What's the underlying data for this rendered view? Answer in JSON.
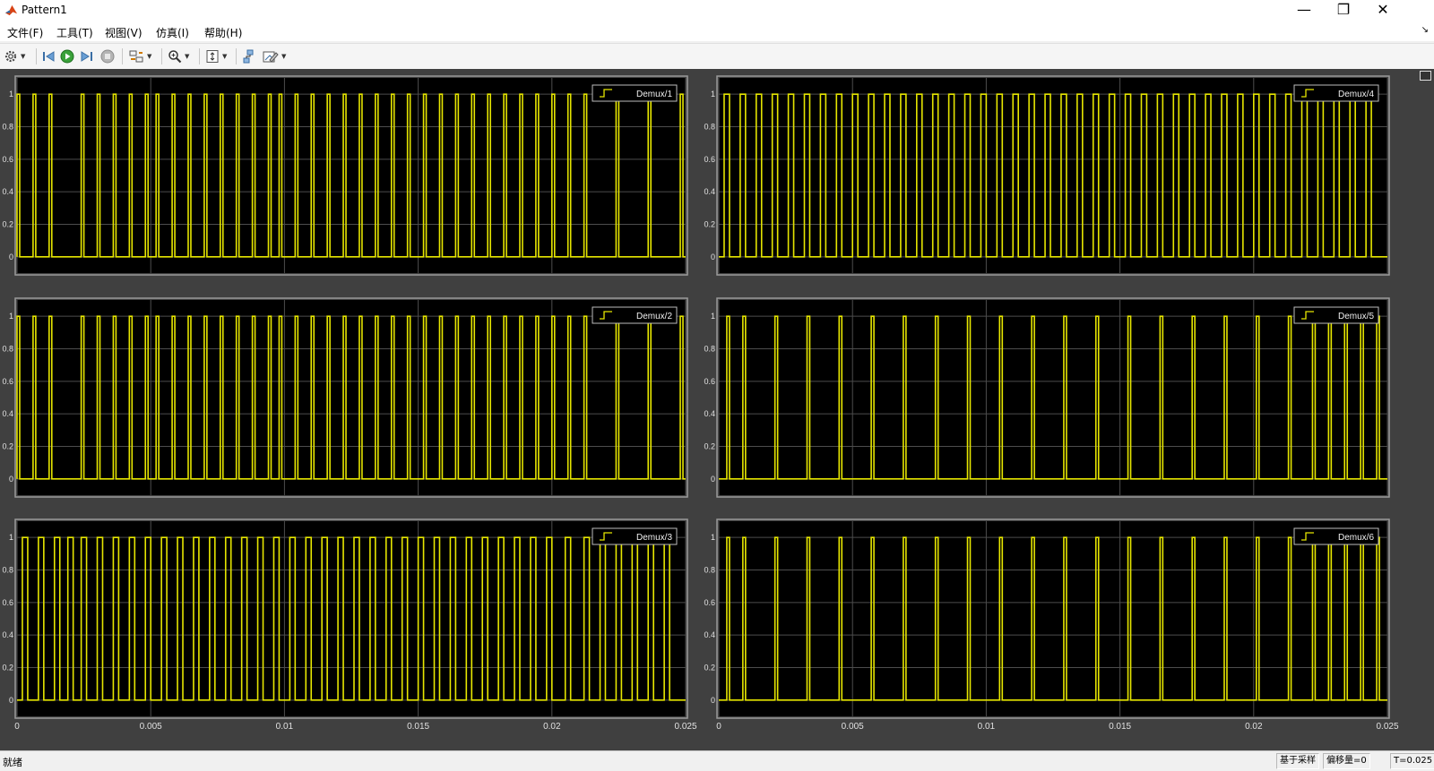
{
  "window": {
    "title": "Pattern1",
    "minimize": "—",
    "maximize": "❐",
    "close": "✕"
  },
  "menu": {
    "items": [
      "文件(F)",
      "工具(T)",
      "视图(V)",
      "仿真(I)",
      "帮助(H)"
    ],
    "undock_glyph": "↘"
  },
  "toolbar": {
    "icons": [
      "gear-icon",
      "step-back-icon",
      "run-icon",
      "step-forward-icon",
      "stop-icon",
      "layout-icon",
      "zoom-icon",
      "scale-axes-icon",
      "highlight-block-icon",
      "style-icon"
    ]
  },
  "colors": {
    "signal": "#e6e600",
    "plot_bg": "#000000",
    "frame_bg": "#404040",
    "grid": "#4d4d4d"
  },
  "plots": {
    "xticks": [
      "0",
      "0.005",
      "0.01",
      "0.015",
      "0.02",
      "0.025"
    ],
    "yticks": [
      "0",
      "0.2",
      "0.4",
      "0.6",
      "0.8",
      "1"
    ],
    "xlim": [
      0,
      0.025
    ],
    "ylim": [
      -0.1,
      1.1
    ],
    "legend_labels": [
      "Demux/1",
      "Demux/2",
      "Demux/3",
      "Demux/4",
      "Demux/5",
      "Demux/6"
    ]
  },
  "chart_data": {
    "type": "line",
    "xlim": [
      0,
      0.025
    ],
    "ylim": [
      -0.1,
      1.1
    ],
    "grid": true,
    "legend": "top-right",
    "series": [
      {
        "name": "Demux/1",
        "shape": "pulse-train",
        "pulse_width": 0.0001,
        "pulse_starts": [
          0,
          0.0006,
          0.0012,
          0.0024,
          0.003,
          0.0036,
          0.0042,
          0.0048,
          0.0052,
          0.0058,
          0.0064,
          0.007,
          0.0076,
          0.0082,
          0.0088,
          0.0094,
          0.0098,
          0.0104,
          0.011,
          0.0116,
          0.0122,
          0.0128,
          0.0134,
          0.014,
          0.0146,
          0.0152,
          0.0158,
          0.0164,
          0.017,
          0.0176,
          0.0182,
          0.0188,
          0.0194,
          0.02,
          0.0206,
          0.0212,
          0.0224,
          0.0236,
          0.0248
        ]
      },
      {
        "name": "Demux/2",
        "shape": "pulse-train",
        "pulse_width": 0.0001,
        "pulse_starts": [
          0,
          0.0006,
          0.0012,
          0.0024,
          0.003,
          0.0036,
          0.0042,
          0.0048,
          0.0052,
          0.0058,
          0.0064,
          0.007,
          0.0076,
          0.0082,
          0.0088,
          0.0094,
          0.0098,
          0.0104,
          0.011,
          0.0116,
          0.0122,
          0.0128,
          0.0134,
          0.014,
          0.0146,
          0.0152,
          0.0158,
          0.0164,
          0.017,
          0.0176,
          0.0182,
          0.0188,
          0.0194,
          0.02,
          0.0206,
          0.0212,
          0.0224,
          0.0236,
          0.0248
        ]
      },
      {
        "name": "Demux/3",
        "shape": "pulse-train",
        "pulse_width": 0.0002,
        "pulse_starts": [
          0.0002,
          0.0008,
          0.0014,
          0.0019,
          0.0024,
          0.003,
          0.0036,
          0.0042,
          0.0048,
          0.0054,
          0.006,
          0.0066,
          0.0072,
          0.0078,
          0.0084,
          0.009,
          0.0096,
          0.0102,
          0.0108,
          0.0114,
          0.012,
          0.0126,
          0.0132,
          0.0138,
          0.0144,
          0.015,
          0.0156,
          0.0162,
          0.0168,
          0.0174,
          0.018,
          0.0186,
          0.0192,
          0.0198,
          0.0205,
          0.0212,
          0.0218,
          0.0224,
          0.023,
          0.0236,
          0.0242
        ]
      },
      {
        "name": "Demux/4",
        "shape": "pulse-train",
        "pulse_width": 0.0002,
        "pulse_starts": [
          0.0002,
          0.0008,
          0.0014,
          0.002,
          0.0026,
          0.0032,
          0.0038,
          0.0044,
          0.005,
          0.0056,
          0.0062,
          0.0068,
          0.0074,
          0.008,
          0.0086,
          0.0092,
          0.0098,
          0.0104,
          0.011,
          0.0116,
          0.0122,
          0.0128,
          0.0134,
          0.014,
          0.0146,
          0.0152,
          0.0158,
          0.0164,
          0.017,
          0.0176,
          0.0182,
          0.0188,
          0.0194,
          0.02,
          0.0206,
          0.0212,
          0.0218,
          0.0224,
          0.023,
          0.0236,
          0.0242
        ]
      },
      {
        "name": "Demux/5",
        "shape": "pulse-train",
        "pulse_width": 0.0001,
        "pulse_starts": [
          0.0003,
          0.0009,
          0.0021,
          0.0033,
          0.0045,
          0.0057,
          0.0069,
          0.0081,
          0.0093,
          0.0105,
          0.0117,
          0.0129,
          0.0141,
          0.0153,
          0.0165,
          0.0177,
          0.0189,
          0.0201,
          0.0213,
          0.0222,
          0.0228,
          0.0234,
          0.024,
          0.0246
        ]
      },
      {
        "name": "Demux/6",
        "shape": "pulse-train",
        "pulse_width": 0.0001,
        "pulse_starts": [
          0.0003,
          0.0009,
          0.0021,
          0.0033,
          0.0045,
          0.0057,
          0.0069,
          0.0081,
          0.0093,
          0.0105,
          0.0117,
          0.0129,
          0.0141,
          0.0153,
          0.0165,
          0.0177,
          0.0189,
          0.0201,
          0.0213,
          0.0222,
          0.0228,
          0.0234,
          0.024,
          0.0246
        ]
      }
    ]
  },
  "status": {
    "ready": "就绪",
    "mode": "基于采样",
    "offset": "偏移量=0",
    "time": "T=0.025"
  }
}
